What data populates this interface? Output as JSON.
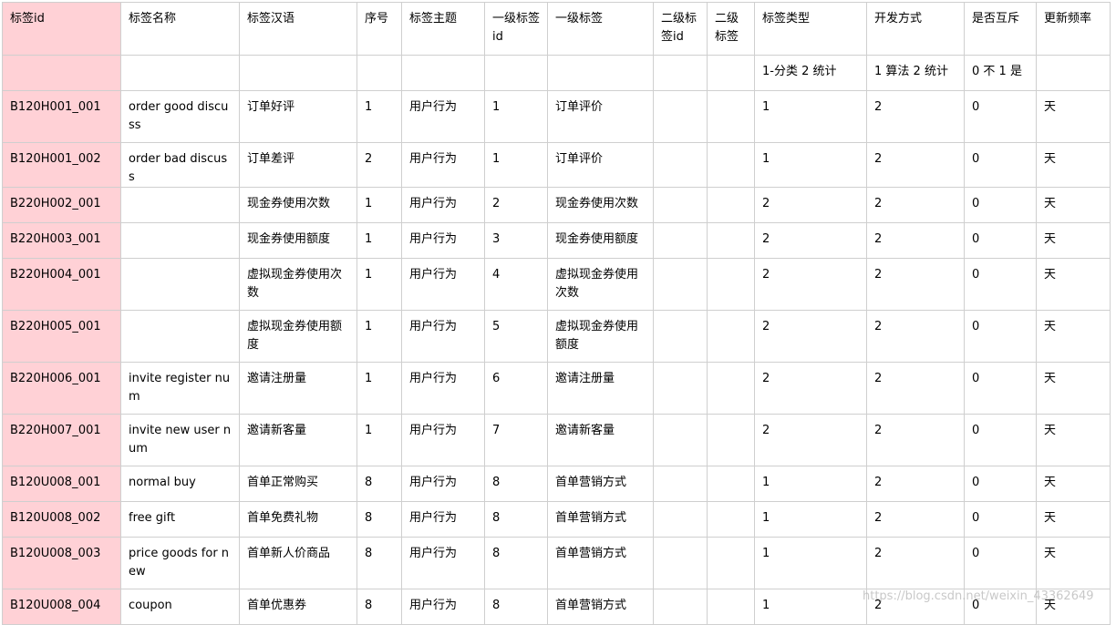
{
  "table": {
    "headers": [
      "标签id",
      "标签名称",
      "标签汉语",
      "序号",
      "标签主题",
      "一级标签id",
      "一级标签",
      "二级标签id",
      "二级标签",
      "标签类型",
      "开发方式",
      "是否互斥",
      "更新频率"
    ],
    "note_row": [
      "",
      "",
      "",
      "",
      "",
      "",
      "",
      "",
      "",
      "1-分类 2 统计",
      "1 算法 2 统计",
      "0 不 1 是",
      ""
    ],
    "rows": [
      [
        "B120H001_001",
        "order good discuss",
        "订单好评",
        "1",
        "用户行为",
        "1",
        "订单评价",
        "",
        "",
        "1",
        "2",
        "0",
        "天"
      ],
      [
        "B120H001_002",
        "order bad discuss",
        "订单差评",
        "2",
        "用户行为",
        "1",
        "订单评价",
        "",
        "",
        "1",
        "2",
        "0",
        "天"
      ],
      [
        "B220H002_001",
        "",
        "现金券使用次数",
        "1",
        "用户行为",
        "2",
        "现金券使用次数",
        "",
        "",
        "2",
        "2",
        "0",
        "天"
      ],
      [
        "B220H003_001",
        "",
        "现金券使用额度",
        "1",
        "用户行为",
        "3",
        "现金券使用额度",
        "",
        "",
        "2",
        "2",
        "0",
        "天"
      ],
      [
        "B220H004_001",
        "",
        "虚拟现金券使用次数",
        "1",
        "用户行为",
        "4",
        "虚拟现金券使用次数",
        "",
        "",
        "2",
        "2",
        "0",
        "天"
      ],
      [
        "B220H005_001",
        "",
        "虚拟现金券使用额度",
        "1",
        "用户行为",
        "5",
        "虚拟现金券使用额度",
        "",
        "",
        "2",
        "2",
        "0",
        "天"
      ],
      [
        "B220H006_001",
        "invite register num",
        "邀请注册量",
        "1",
        "用户行为",
        "6",
        "邀请注册量",
        "",
        "",
        "2",
        "2",
        "0",
        "天"
      ],
      [
        "B220H007_001",
        "invite new user num",
        "邀请新客量",
        "1",
        "用户行为",
        "7",
        "邀请新客量",
        "",
        "",
        "2",
        "2",
        "0",
        "天"
      ],
      [
        "B120U008_001",
        "normal buy",
        "首单正常购买",
        "8",
        "用户行为",
        "8",
        "首单营销方式",
        "",
        "",
        "1",
        "2",
        "0",
        "天"
      ],
      [
        "B120U008_002",
        "free gift",
        "首单免费礼物",
        "8",
        "用户行为",
        "8",
        "首单营销方式",
        "",
        "",
        "1",
        "2",
        "0",
        "天"
      ],
      [
        "B120U008_003",
        "price goods for new",
        "首单新人价商品",
        "8",
        "用户行为",
        "8",
        "首单营销方式",
        "",
        "",
        "1",
        "2",
        "0",
        "天"
      ],
      [
        "B120U008_004",
        "coupon",
        "首单优惠券",
        "8",
        "用户行为",
        "8",
        "首单营销方式",
        "",
        "",
        "1",
        "2",
        "0",
        "天"
      ]
    ],
    "row_heights": [
      "r2",
      "r1",
      "r1",
      "r1",
      "r2",
      "r2",
      "r2",
      "r2",
      "r1",
      "r1",
      "r2",
      "r1"
    ]
  },
  "colors": {
    "id_column_bg": "#ffd1d6",
    "border": "#cfcfcf"
  },
  "watermark": "https://blog.csdn.net/weixin_43362649"
}
